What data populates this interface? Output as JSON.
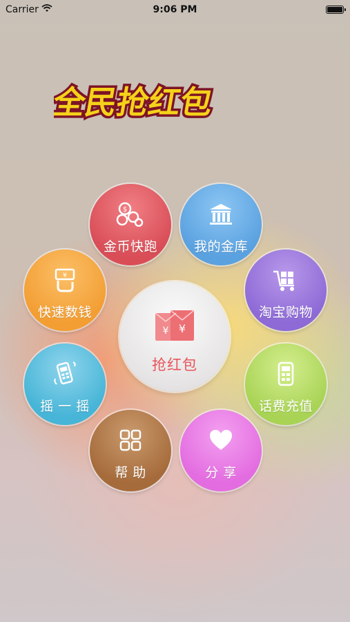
{
  "status_bar": {
    "carrier": "Carrier",
    "time": "9:06 PM"
  },
  "logo": {
    "text": "全民抢红包"
  },
  "menu": {
    "jinbi": {
      "label": "金币快跑",
      "icon": "coins-icon",
      "color": "#d94d57"
    },
    "jinku": {
      "label": "我的金库",
      "icon": "bank-icon",
      "color": "#5aa1e0"
    },
    "kuaisu": {
      "label": "快速数钱",
      "icon": "money-count-icon",
      "color": "#f39e33"
    },
    "taobao": {
      "label": "淘宝购物",
      "icon": "cart-icon",
      "color": "#8d6ad6"
    },
    "yao": {
      "label": "摇 一 摇",
      "icon": "shake-phone-icon",
      "color": "#46b5d7"
    },
    "huafei": {
      "label": "话费充值",
      "icon": "phone-recharge-icon",
      "color": "#a8d355"
    },
    "bangzhu": {
      "label": "帮 助",
      "icon": "grid-icon",
      "color": "#a66b3b"
    },
    "fenxiang": {
      "label": "分 享",
      "icon": "heart-icon",
      "color": "#e36ce0"
    }
  },
  "center": {
    "label": "抢红包",
    "icon": "red-envelope-icon",
    "color": "#e8545c"
  }
}
